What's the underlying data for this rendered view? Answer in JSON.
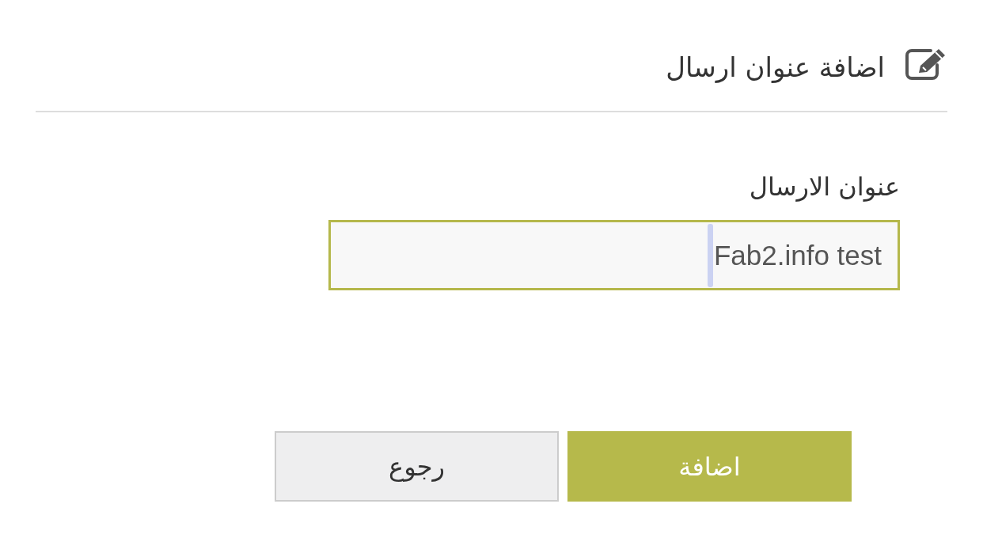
{
  "header": {
    "title": "اضافة عنوان ارسال"
  },
  "form": {
    "fields": [
      {
        "label": "عنوان الارسال",
        "value": "Fab2.info test",
        "focused": true
      }
    ]
  },
  "buttons": [
    {
      "label": "اضافة",
      "kind": "primary"
    },
    {
      "label": "رجوع",
      "kind": "secondary"
    }
  ]
}
